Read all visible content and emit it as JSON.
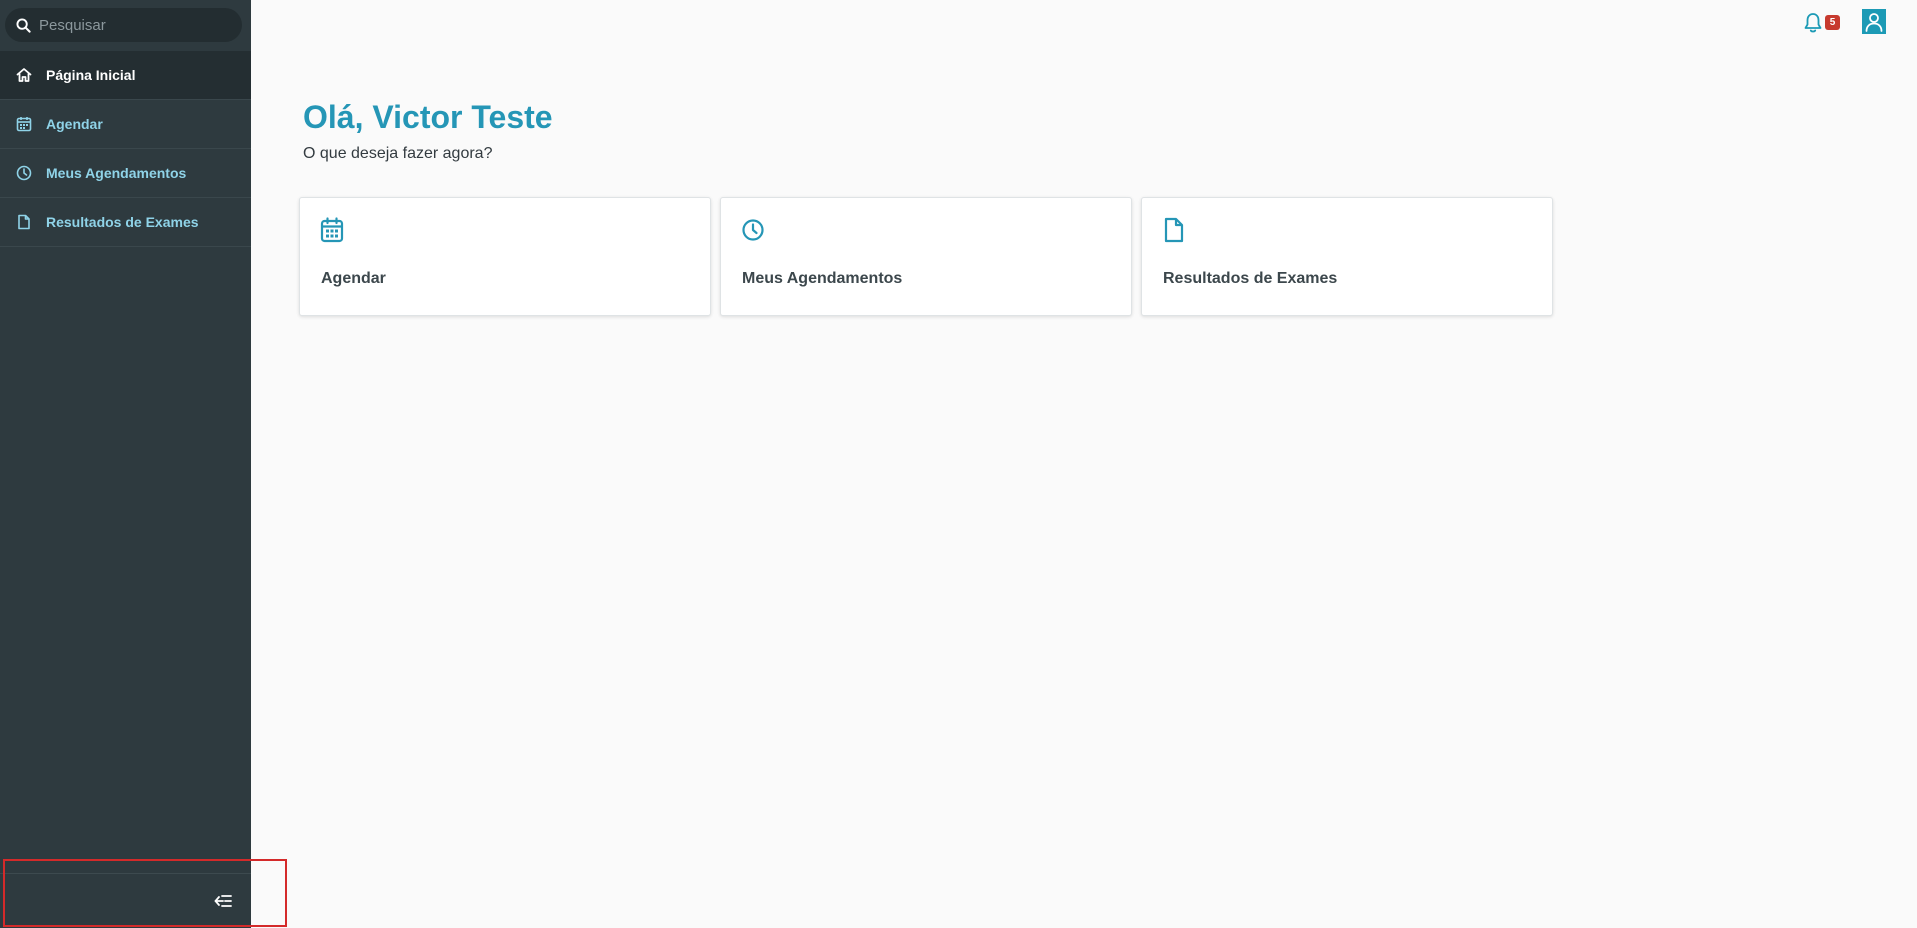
{
  "sidebar": {
    "search": {
      "placeholder": "Pesquisar"
    },
    "items": [
      {
        "label": "Página Inicial",
        "icon": "home-icon",
        "active": true
      },
      {
        "label": "Agendar",
        "icon": "calendar-icon",
        "active": false
      },
      {
        "label": "Meus Agendamentos",
        "icon": "clock-icon",
        "active": false
      },
      {
        "label": "Resultados de Exames",
        "icon": "document-icon",
        "active": false
      }
    ],
    "footer": {
      "collapse_icon": "collapse-menu-icon"
    }
  },
  "header": {
    "notifications": {
      "icon": "bell-icon",
      "count": "5"
    },
    "profile": {
      "icon": "user-icon"
    }
  },
  "main": {
    "greeting": "Olá, Victor Teste",
    "subtitle": "O que deseja fazer agora?",
    "cards": [
      {
        "label": "Agendar",
        "icon": "calendar-icon"
      },
      {
        "label": "Meus Agendamentos",
        "icon": "clock-icon"
      },
      {
        "label": "Resultados de Exames",
        "icon": "document-icon"
      }
    ]
  },
  "colors": {
    "sidebar_bg": "#2e3a3f",
    "sidebar_active_bg": "#242e32",
    "menu_text": "#8fd3e8",
    "accent": "#2596b6",
    "badge": "#c73a2e",
    "highlight": "#d42a2a"
  }
}
